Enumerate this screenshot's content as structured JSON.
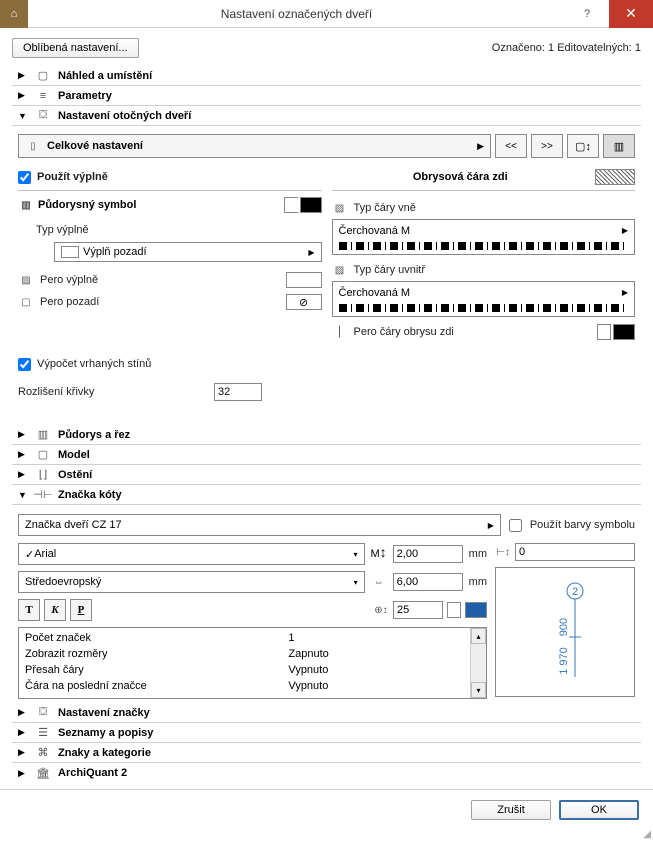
{
  "titlebar": {
    "title": "Nastavení označených dveří",
    "help": "?",
    "close": "✕"
  },
  "top": {
    "fav_btn": "Oblíbená nastavení...",
    "status": "Označeno: 1 Editovatelných: 1"
  },
  "sections": {
    "preview": "Náhled a umístění",
    "params": "Parametry",
    "rot_door": "Nastavení otočných dveří",
    "floor_cut": "Půdorys a řez",
    "model": "Model",
    "reveal": "Ostění",
    "dim_marker": "Značka kóty",
    "marker_settings": "Nastavení značky",
    "lists": "Seznamy a popisy",
    "cats": "Znaky a kategorie",
    "aq": "ArchiQuant 2"
  },
  "rot_panel": {
    "overall_dd": "Celkové nastavení",
    "prev_btn": "<<",
    "next_btn": ">>",
    "use_fills_chk": "Použít výplně",
    "floor_symbol": "Půdorysný symbol",
    "fill_type_lbl": "Typ výplně",
    "fill_type_val": "Výplň pozadí",
    "pen_fill": "Pero výplně",
    "pen_bg": "Pero pozadí",
    "wall_contour": "Obrysová čára zdi",
    "line_out_lbl": "Typ čáry vně",
    "line_out_val": "Čerchovaná M",
    "line_in_lbl": "Typ čáry uvnitř",
    "line_in_val": "Čerchovaná M",
    "contour_pen": "Pero čáry obrysu zdi",
    "shadow_chk": "Výpočet vrhaných stínů",
    "curve_res_lbl": "Rozlišení křivky",
    "curve_res_val": "32"
  },
  "dim_panel": {
    "marker_dd": "Značka dveří CZ 17",
    "use_sym_colors": "Použít barvy symbolu",
    "font_dd": "Arial",
    "charset_dd": "Středoevropský",
    "size_val": "2,00",
    "width_val": "6,00",
    "mm1": "mm",
    "mm2": "mm",
    "pen_val": "25",
    "zero_val": "0",
    "list": [
      {
        "k": "Počet značek",
        "v": "1"
      },
      {
        "k": "Zobrazit rozměry",
        "v": "Zapnuto"
      },
      {
        "k": "Přesah čáry",
        "v": "Vypnuto"
      },
      {
        "k": "Čára na poslední značce",
        "v": "Vypnuto"
      }
    ],
    "M_label": "M",
    "preview_num": "2",
    "preview_h1": "900",
    "preview_h2": "1 970"
  },
  "footer": {
    "cancel": "Zrušit",
    "ok": "OK"
  }
}
